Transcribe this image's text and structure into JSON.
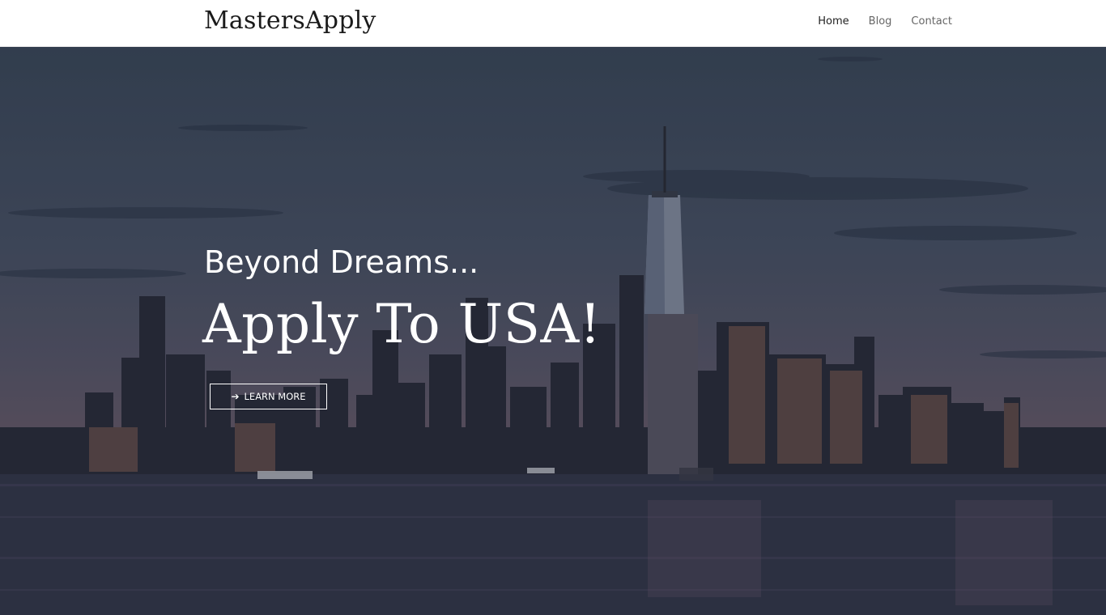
{
  "header": {
    "brand": "MastersApply",
    "nav": [
      {
        "label": "Home",
        "active": true
      },
      {
        "label": "Blog",
        "active": false
      },
      {
        "label": "Contact",
        "active": false
      }
    ]
  },
  "hero": {
    "tagline": "Beyond Dreams...",
    "headline": "Apply To USA!",
    "cta_label": "LEARN MORE",
    "cta_icon": "arrow-right-icon",
    "background": "city-skyline-at-dusk"
  },
  "colors": {
    "header_bg": "#ffffff",
    "brand_text": "#1a1a1a",
    "nav_text": "#666666",
    "hero_text": "#ffffff"
  }
}
